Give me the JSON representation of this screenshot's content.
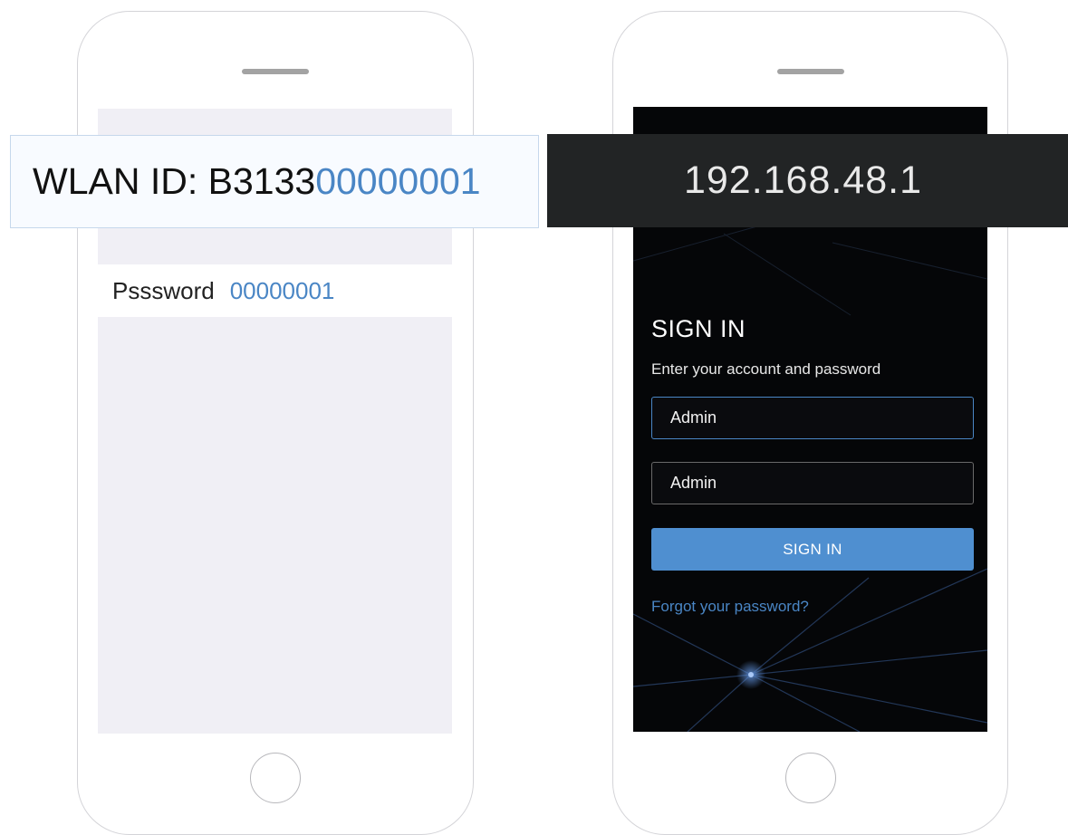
{
  "wifi_phone": {
    "wlan_banner": {
      "prefix": "WLAN ID: B3133",
      "highlight": "00000001"
    },
    "password_row": {
      "label": "Psssword",
      "value": "00000001"
    }
  },
  "login_phone": {
    "ip_banner": "192.168.48.1",
    "title": "SIGN IN",
    "subtitle": "Enter your account and password",
    "account_value": "Admin",
    "password_value": "Admin",
    "sign_in_button": "SIGN IN",
    "forgot_link": "Forgot your password?"
  },
  "colors": {
    "accent_blue": "#4a86c5",
    "button_blue": "#4f8fd0",
    "dark_screen": "#050608",
    "light_screen": "#f0eff5",
    "ip_banner_bg": "#222425"
  },
  "icons": [
    "speaker-slot-icon",
    "home-button-icon"
  ]
}
